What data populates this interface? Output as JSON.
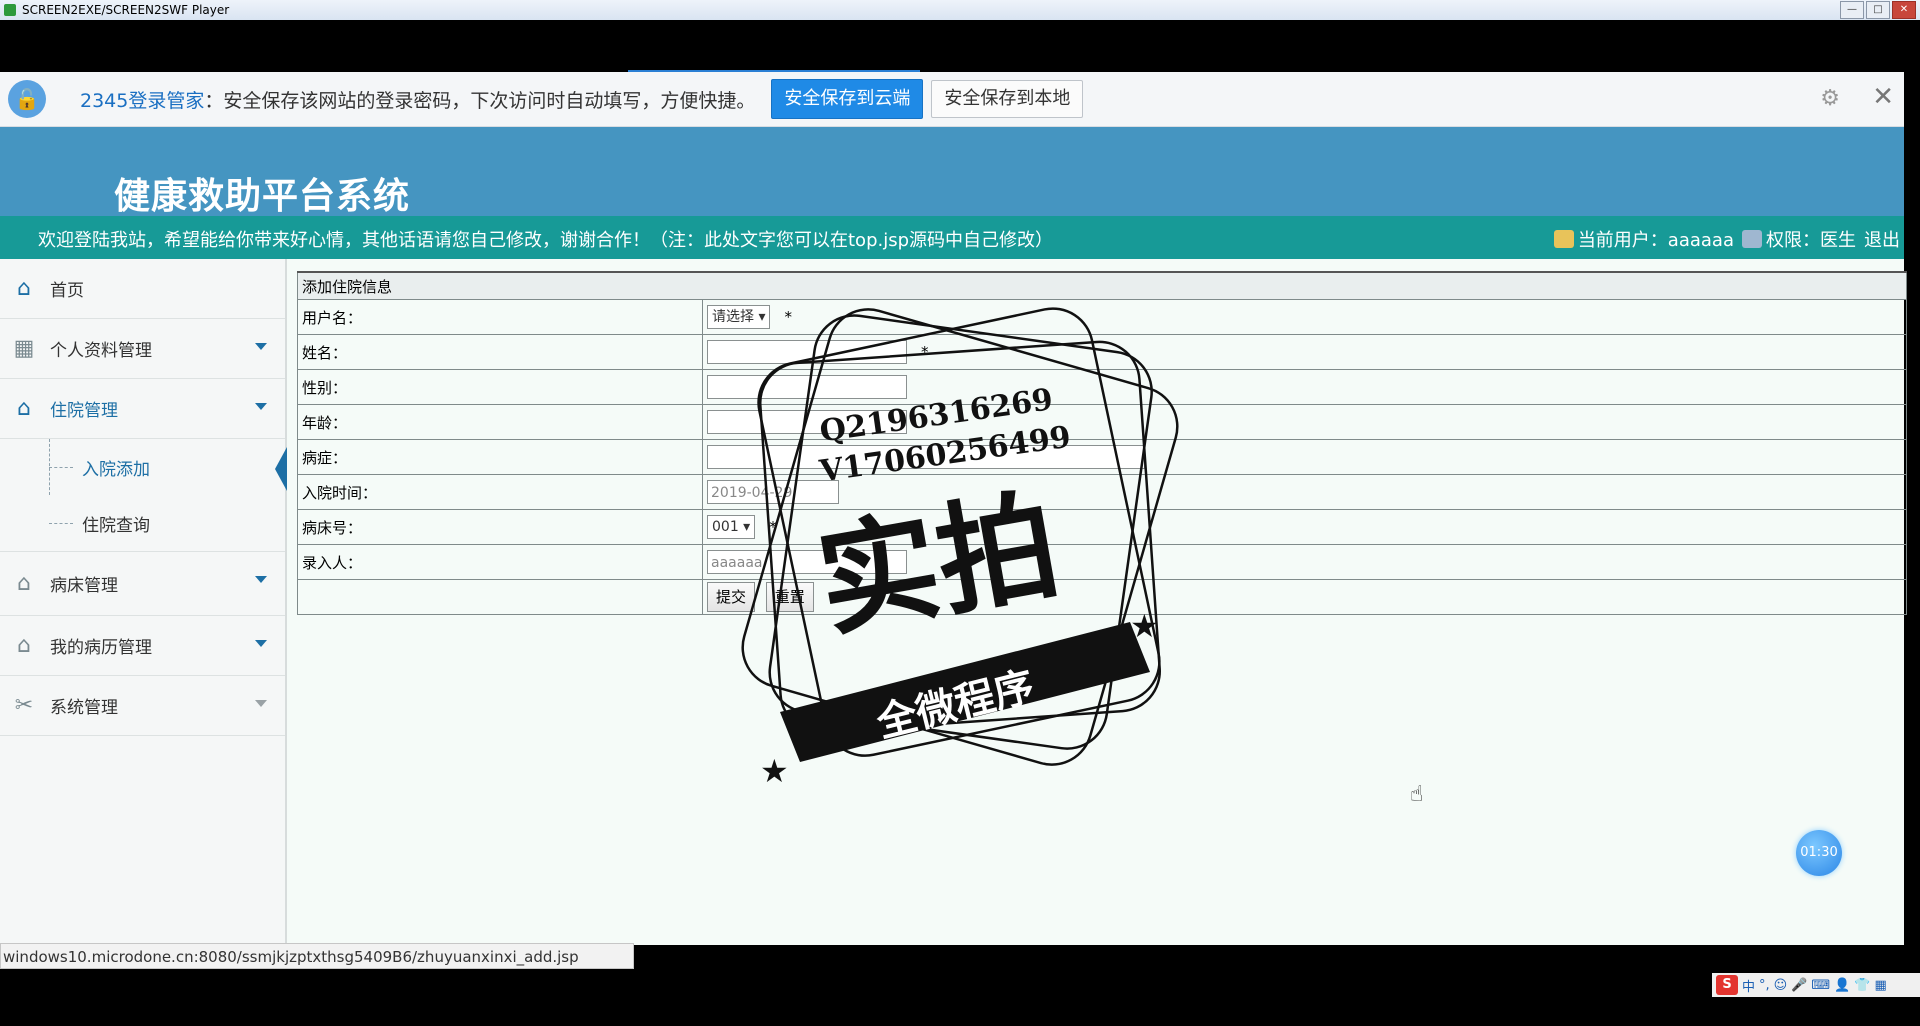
{
  "window": {
    "title": "SCREEN2EXE/SCREEN2SWF Player"
  },
  "login_bar": {
    "brand": "2345登录管家",
    "message": "：安全保存该网站的登录密码，下次访问时自动填写，方便快捷。",
    "save_cloud": "安全保存到云端",
    "save_local": "安全保存到本地"
  },
  "header": {
    "title": "健康救助平台系统"
  },
  "welcome": {
    "text": "欢迎登陆我站，希望能给你带来好心情，其他话语请您自己修改，谢谢合作！（注：此处文字您可以在top.jsp源码中自己修改）",
    "current_user": "当前用户：aaaaaa",
    "role": "权限：医生",
    "logout": "退出"
  },
  "sidebar": {
    "items": [
      {
        "label": "首页"
      },
      {
        "label": "个人资料管理"
      },
      {
        "label": "住院管理",
        "children": [
          {
            "label": "入院添加"
          },
          {
            "label": "住院查询"
          }
        ]
      },
      {
        "label": "病床管理"
      },
      {
        "label": "我的病历管理"
      },
      {
        "label": "系统管理"
      }
    ]
  },
  "form": {
    "title": "添加住院信息",
    "fields": {
      "username": {
        "label": "用户名：",
        "value": "请选择"
      },
      "name": {
        "label": "姓名："
      },
      "gender": {
        "label": "性别："
      },
      "age": {
        "label": "年龄："
      },
      "disease": {
        "label": "病症："
      },
      "admit_time": {
        "label": "入院时间：",
        "value": "2019-04-29"
      },
      "bed_no": {
        "label": "病床号：",
        "value": "001"
      },
      "recorder": {
        "label": "录入人：",
        "value": "aaaaaa"
      }
    },
    "required_mark": "*",
    "submit": "提交",
    "reset": "重置"
  },
  "watermark": {
    "line1": "Q2196316269",
    "line2": "V17060256499",
    "big": "实拍",
    "banner": "全微程序"
  },
  "timer": "01:30",
  "status_url": "windows10.microdone.cn:8080/ssmjkjzptxthsg5409B6/zhuyuanxinxi_add.jsp",
  "tray": {
    "text": "中"
  }
}
